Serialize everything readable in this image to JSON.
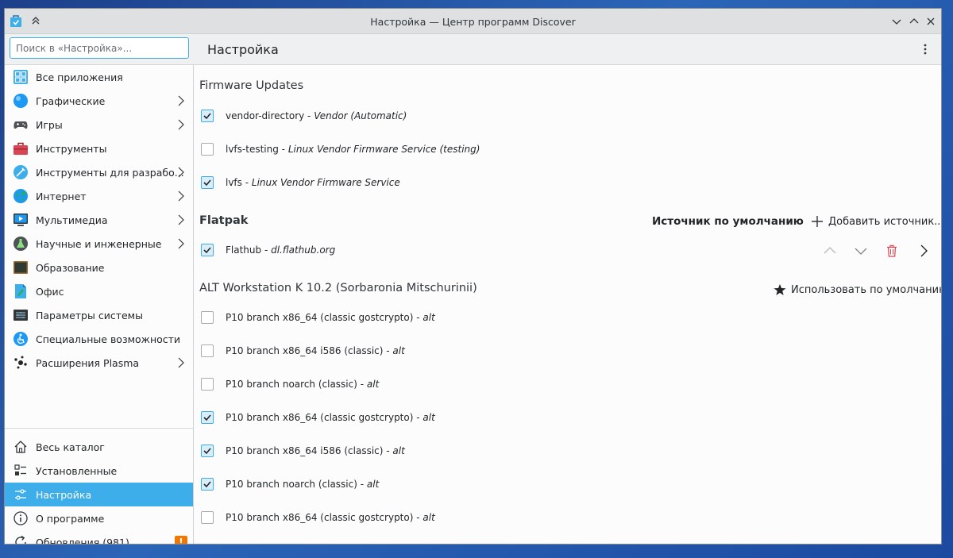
{
  "window": {
    "title": "Настройка — Центр программ Discover"
  },
  "search": {
    "placeholder": "Поиск в «Настройка»..."
  },
  "page_title": "Настройка",
  "sidebar": {
    "categories": [
      {
        "label": "Все приложения",
        "icon": "all-apps-icon",
        "chevron": false
      },
      {
        "label": "Графические",
        "icon": "graphics-icon",
        "chevron": true
      },
      {
        "label": "Игры",
        "icon": "gamepad-icon",
        "chevron": true
      },
      {
        "label": "Инструменты",
        "icon": "toolbox-icon",
        "chevron": false
      },
      {
        "label": "Инструменты для разрабо...",
        "icon": "dev-tools-icon",
        "chevron": true
      },
      {
        "label": "Интернет",
        "icon": "globe-icon",
        "chevron": true
      },
      {
        "label": "Мультимедиа",
        "icon": "multimedia-icon",
        "chevron": true
      },
      {
        "label": "Научные и инженерные",
        "icon": "flask-icon",
        "chevron": true
      },
      {
        "label": "Образование",
        "icon": "education-icon",
        "chevron": false
      },
      {
        "label": "Офис",
        "icon": "office-icon",
        "chevron": false
      },
      {
        "label": "Параметры системы",
        "icon": "system-settings-icon",
        "chevron": false
      },
      {
        "label": "Специальные возможности",
        "icon": "accessibility-icon",
        "chevron": false
      },
      {
        "label": "Расширения Plasma",
        "icon": "plasma-icon",
        "chevron": true
      }
    ],
    "bottom": [
      {
        "label": "Весь каталог",
        "icon": "home-icon",
        "active": false
      },
      {
        "label": "Установленные",
        "icon": "installed-icon",
        "active": false
      },
      {
        "label": "Настройка",
        "icon": "settings-sliders-icon",
        "active": true
      },
      {
        "label": "О программе",
        "icon": "info-icon",
        "active": false
      },
      {
        "label": "Обновления (981)",
        "icon": "updates-icon",
        "active": false,
        "badge": "!"
      }
    ]
  },
  "sections": {
    "firmware": {
      "title": "Firmware Updates",
      "items": [
        {
          "name": "vendor-directory",
          "desc": "Vendor (Automatic)",
          "checked": true
        },
        {
          "name": "lvfs-testing",
          "desc": "Linux Vendor Firmware Service (testing)",
          "checked": false
        },
        {
          "name": "lvfs",
          "desc": "Linux Vendor Firmware Service",
          "checked": true
        }
      ]
    },
    "flatpak": {
      "title": "Flatpak",
      "default_source_label": "Источник по умолчанию",
      "add_source_label": "Добавить источник...",
      "items": [
        {
          "name": "Flathub",
          "desc": "dl.flathub.org",
          "checked": true
        }
      ]
    },
    "alt": {
      "title": "ALT Workstation K 10.2 (Sorbaronia Mitschurinii)",
      "use_default_label": "Использовать по умолчанию",
      "items": [
        {
          "name": "P10 branch x86_64 (classic gostcrypto)",
          "desc": "alt",
          "checked": false
        },
        {
          "name": "P10 branch x86_64 i586 (classic)",
          "desc": "alt",
          "checked": false
        },
        {
          "name": "P10 branch noarch (classic)",
          "desc": "alt",
          "checked": false
        },
        {
          "name": "P10 branch x86_64 (classic gostcrypto)",
          "desc": "alt",
          "checked": true
        },
        {
          "name": "P10 branch x86_64 i586 (classic)",
          "desc": "alt",
          "checked": true
        },
        {
          "name": "P10 branch noarch (classic)",
          "desc": "alt",
          "checked": true
        },
        {
          "name": "P10 branch x86_64 (classic gostcrypto)",
          "desc": "alt",
          "checked": false
        }
      ]
    }
  },
  "colors": {
    "accent": "#3daee9",
    "delete": "#da4453",
    "badge": "#f67400"
  }
}
